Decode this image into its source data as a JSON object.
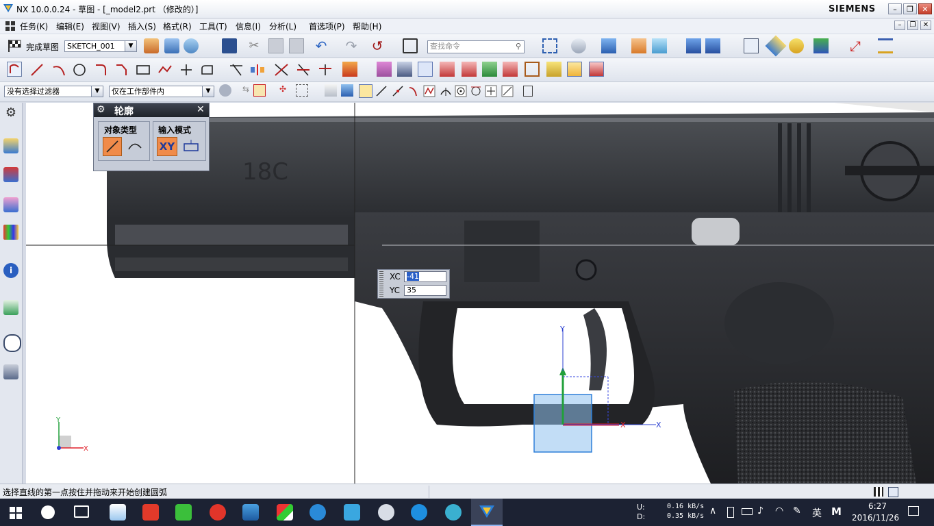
{
  "window": {
    "title": "NX 10.0.0.24 - 草图 - [_model2.prt （修改的）]",
    "brand": "SIEMENS",
    "min_label": "–",
    "max_label": "❐",
    "close_label": "✕"
  },
  "menu": {
    "items": [
      "任务(K)",
      "编辑(E)",
      "视图(V)",
      "插入(S)",
      "格式(R)",
      "工具(T)",
      "信息(I)",
      "分析(L)",
      "首选项(P)",
      "帮助(H)"
    ]
  },
  "toolbar1": {
    "finish_sketch_label": "完成草图",
    "sketch_name": "SKETCH_001",
    "search_placeholder": "查找命令"
  },
  "selection_bar": {
    "filter_value": "没有选择过滤器",
    "scope_value": "仅在工作部件内"
  },
  "profile_dialog": {
    "title": "轮廓",
    "object_type_label": "对象类型",
    "input_mode_label": "输入模式",
    "xy_label": "XY"
  },
  "coord_input": {
    "xc_label": "XC",
    "xc_value": "-41",
    "yc_label": "YC",
    "yc_value": "35"
  },
  "graphics": {
    "csys_x": "X",
    "csys_y": "Y",
    "triad_x": "X",
    "triad_y": "Y",
    "pistol_text": "18C"
  },
  "status": {
    "message": "选择直线的第一点按住并拖动来开始创建圆弧"
  },
  "taskbar": {
    "net_up_label": "U:",
    "net_down_label": "D:",
    "net_up": "0.16 kB/s",
    "net_down": "0.35 kB/s",
    "ime": "英",
    "time": "6:27",
    "date": "2016/11/26"
  },
  "colors": {
    "accent_orange": "#f08b4a",
    "taskbar": "#1c2233",
    "csys_red": "#e0202a",
    "csys_green": "#21a03a",
    "csys_blue": "#2a3fd0"
  }
}
